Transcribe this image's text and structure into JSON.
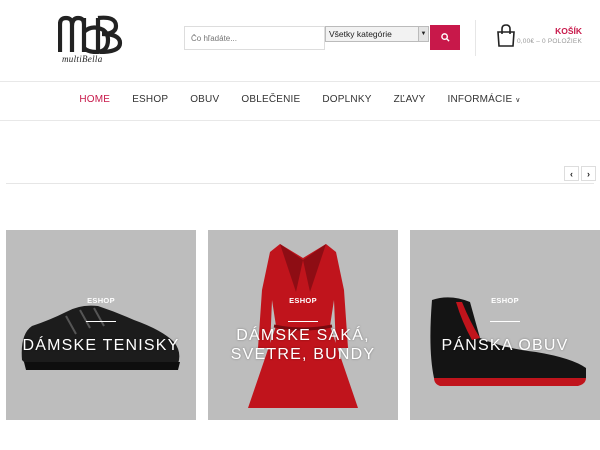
{
  "header": {
    "logo_text": "MB",
    "logo_tagline": "multiBella",
    "search": {
      "placeholder": "Čo hľadáte..."
    },
    "category_select": {
      "value": "Všetky kategórie"
    },
    "cart": {
      "title": "KOŠÍK",
      "summary": "0,00€ – 0 POLOŽIEK"
    }
  },
  "nav": {
    "items": [
      {
        "label": "HOME"
      },
      {
        "label": "ESHOP"
      },
      {
        "label": "OBUV"
      },
      {
        "label": "OBLEČENIE"
      },
      {
        "label": "DOPLNKY"
      },
      {
        "label": "ZĽAVY"
      },
      {
        "label": "INFORMÁCIE"
      }
    ]
  },
  "slider": {
    "prev": "‹",
    "next": "›"
  },
  "tiles": [
    {
      "tag": "ESHOP",
      "title_lines": [
        "DÁMSKE TENISKY"
      ]
    },
    {
      "tag": "ESHOP",
      "title_lines": [
        "DÁMSKE SAKÁ,",
        "SVETRE, BUNDY"
      ]
    },
    {
      "tag": "ESHOP",
      "title_lines": [
        "PÁNSKA OBUV"
      ]
    }
  ],
  "colors": {
    "accent": "#c8184a",
    "tile_bg": "#bdbdbd"
  },
  "icons": {
    "search": "search-icon",
    "cart": "shopping-bag-icon",
    "dropdown": "chevron-down-icon"
  }
}
